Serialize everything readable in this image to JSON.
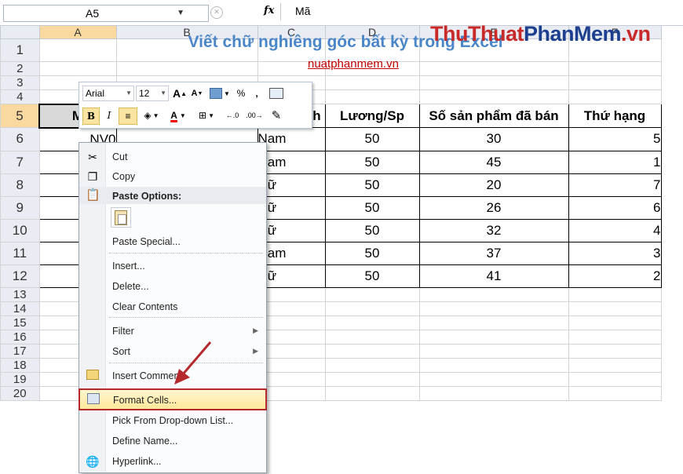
{
  "formula_bar": {
    "name_box": "A5",
    "fx": "fx",
    "value": "Mã"
  },
  "watermark": {
    "part1": "ThuThuat",
    "part2": "PhanMem",
    "part3": ".vn"
  },
  "columns": [
    "A",
    "B",
    "C",
    "D",
    "E",
    "F"
  ],
  "rows": [
    "1",
    "2",
    "3",
    "4",
    "5",
    "6",
    "7",
    "8",
    "9",
    "10",
    "11",
    "12",
    "13",
    "14",
    "15",
    "16",
    "17",
    "18",
    "19",
    "20"
  ],
  "sheet": {
    "title": "Viết chữ nghiêng góc bất kỳ trong Excel",
    "link": "nuatphanmem.vn",
    "header": {
      "a": "M",
      "c": "Giới Tính",
      "d": "Lương/Sp",
      "e": "Số sản phẩm đã bán",
      "f": "Thứ hạng"
    },
    "data": [
      {
        "a": "NV0",
        "c": "Nam",
        "d": "50",
        "e": "30",
        "f": "5"
      },
      {
        "a": "NV0",
        "c": "Nam",
        "d": "50",
        "e": "45",
        "f": "1"
      },
      {
        "a": "NV0",
        "c": "Nữ",
        "d": "50",
        "e": "20",
        "f": "7"
      },
      {
        "a": "NV0",
        "c": "Nữ",
        "d": "50",
        "e": "26",
        "f": "6"
      },
      {
        "a": "NV0",
        "c": "Nữ",
        "d": "50",
        "e": "32",
        "f": "4"
      },
      {
        "a": "NV0",
        "c": "Nam",
        "d": "50",
        "e": "37",
        "f": "3"
      },
      {
        "a": "NV0",
        "c": "Nữ",
        "d": "50",
        "e": "41",
        "f": "2"
      }
    ]
  },
  "mini_toolbar": {
    "font": "Arial",
    "size": "12",
    "percent": "%",
    "comma": ",",
    "bold": "B",
    "italic": "I",
    "font_color": "A"
  },
  "context_menu": {
    "cut": "Cut",
    "copy": "Copy",
    "paste_options": "Paste Options:",
    "paste_special": "Paste Special...",
    "insert": "Insert...",
    "delete": "Delete...",
    "clear_contents": "Clear Contents",
    "filter": "Filter",
    "sort": "Sort",
    "insert_comment": "Insert Comment",
    "format_cells": "Format Cells...",
    "pick_list": "Pick From Drop-down List...",
    "define_name": "Define Name...",
    "hyperlink": "Hyperlink..."
  },
  "colors": {
    "accent": "#4a86c8",
    "highlight": "#b5282c",
    "watermark_red": "#c82a2a",
    "watermark_blue": "#1d3f8f"
  }
}
